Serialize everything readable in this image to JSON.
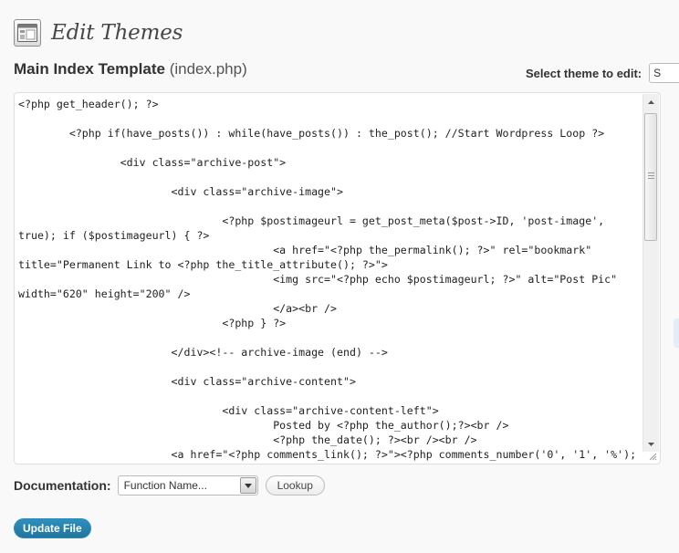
{
  "page": {
    "title": "Edit Themes",
    "icon": "appearance-themes-icon"
  },
  "file": {
    "name": "Main Index Template",
    "path": "(index.php)"
  },
  "theme_select": {
    "label": "Select theme to edit:",
    "value": "S"
  },
  "editor": {
    "lines": [
      "<?php get_header(); ?>",
      "",
      "        <?php if(have_posts()) : while(have_posts()) : the_post(); //Start Wordpress Loop ?>",
      "",
      "                <div class=\"archive-post\">",
      "",
      "                        <div class=\"archive-image\">",
      "",
      "                                <?php $postimageurl = get_post_meta($post->ID, 'post-image',",
      "true); if ($postimageurl) { ?>",
      "                                        <a href=\"<?php the_permalink(); ?>\" rel=\"bookmark\"",
      "title=\"Permanent Link to <?php the_title_attribute(); ?>\">",
      "                                        <img src=\"<?php echo $postimageurl; ?>\" alt=\"Post Pic\"",
      "width=\"620\" height=\"200\" />",
      "                                        </a><br />",
      "                                <?php } ?>",
      "",
      "                        </div><!-- archive-image (end) -->",
      "",
      "                        <div class=\"archive-content\">",
      "",
      "                                <div class=\"archive-content-left\">",
      "                                        Posted by <?php the_author();?><br />",
      "                                        <?php the_date(); ?><br /><br />",
      "                        <a href=\"<?php comments_link(); ?>\"><?php comments_number('0', '1', '%');"
    ]
  },
  "documentation": {
    "label": "Documentation:",
    "select_value": "Function Name...",
    "lookup_label": "Lookup"
  },
  "actions": {
    "update_label": "Update File"
  },
  "colors": {
    "primary_button": "#21759b",
    "background": "#f9f9f9"
  }
}
